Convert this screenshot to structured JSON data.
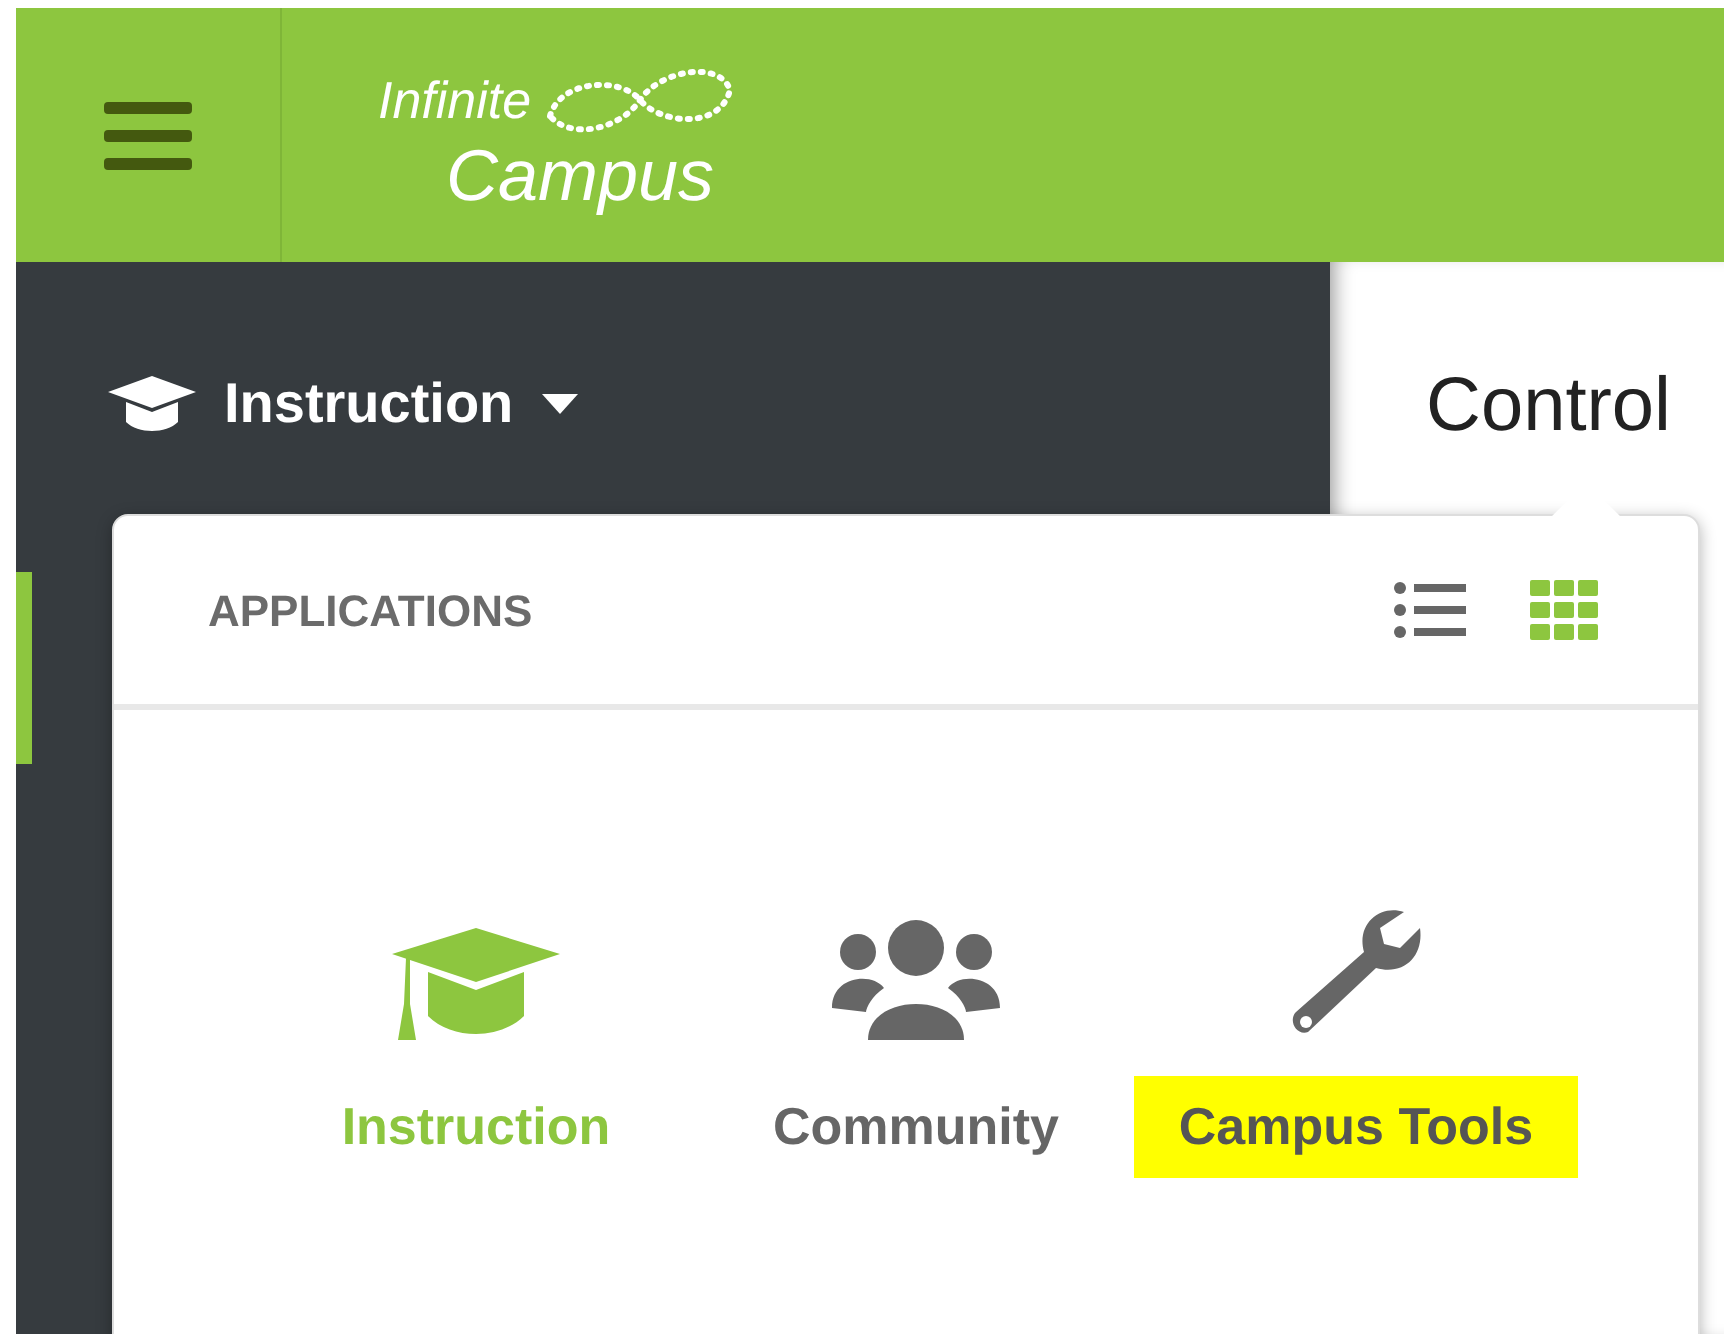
{
  "header": {
    "logo": {
      "line_1": "Infinite",
      "line_2": "Campus"
    }
  },
  "product_switcher": {
    "label": "Instruction",
    "expanded": true
  },
  "page_title": "Control",
  "applications_menu": {
    "title": "APPLICATIONS",
    "views": [
      {
        "kind": "list",
        "selected": false
      },
      {
        "kind": "grid",
        "selected": true
      }
    ],
    "apps": [
      {
        "kind": "cap",
        "label": "Instruction",
        "selected": true,
        "highlighted": false
      },
      {
        "kind": "people",
        "label": "Community",
        "selected": false,
        "highlighted": false
      },
      {
        "kind": "wrench",
        "label": "Campus Tools",
        "selected": false,
        "highlighted": true
      }
    ]
  }
}
